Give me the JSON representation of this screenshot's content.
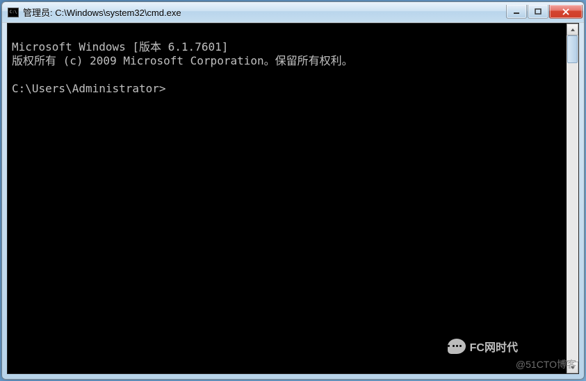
{
  "window": {
    "title": "管理员: C:\\Windows\\system32\\cmd.exe"
  },
  "terminal": {
    "line1": "Microsoft Windows [版本 6.1.7601]",
    "line2": "版权所有 (c) 2009 Microsoft Corporation。保留所有权利。",
    "blank": "",
    "prompt": "C:\\Users\\Administrator>"
  },
  "watermark": {
    "brand": "FC网时代",
    "sub": "@51CTO博客"
  }
}
